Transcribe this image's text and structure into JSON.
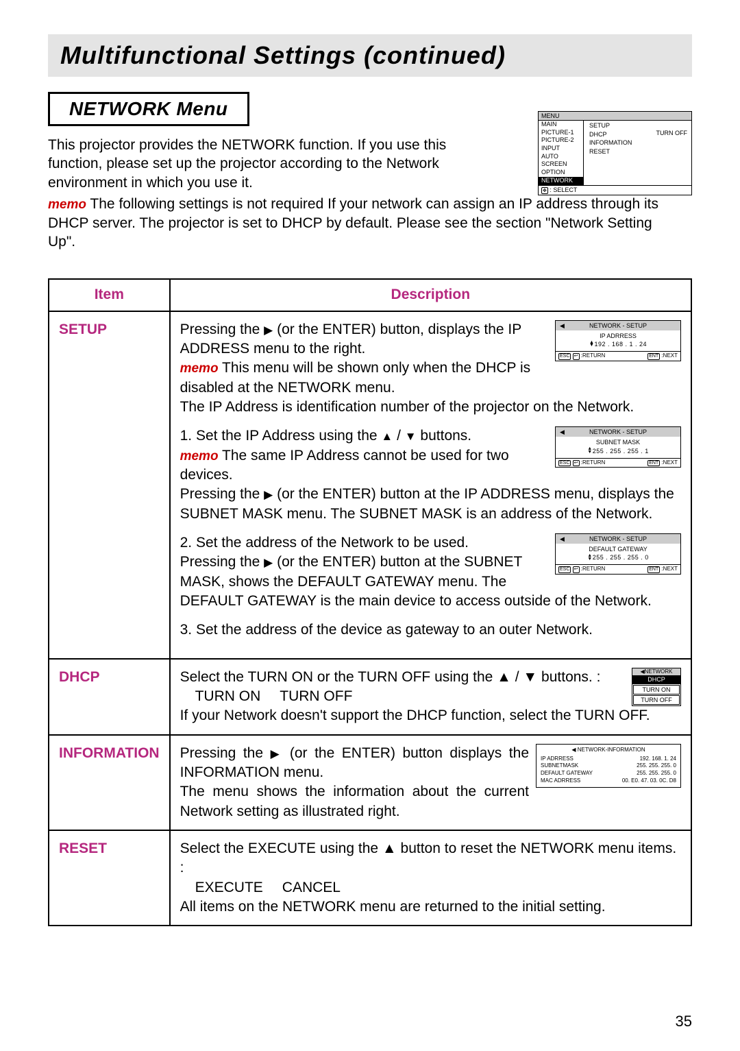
{
  "page_title": "Multifunctional Settings (continued)",
  "section_title": "NETWORK Menu",
  "intro": "This projector provides the NETWORK function. If you use this function, please set up the projector according to the Network environment in which you use it.",
  "memo_label": "memo",
  "memo_text": " The following settings is not required If your network can assign an IP address through its DHCP server.  The projector is set to DHCP by default. Please see the section \"Network Setting Up\".",
  "menu_box": {
    "title": "MENU",
    "left": [
      "MAIN",
      "PICTURE-1",
      "PICTURE-2",
      "INPUT",
      "AUTO",
      "SCREEN",
      "OPTION",
      "NETWORK"
    ],
    "right": [
      "SETUP",
      "DHCP",
      "INFORMATION",
      "RESET"
    ],
    "turnoff": "TURN OFF",
    "footer": ": SELECT"
  },
  "table": {
    "head_item": "Item",
    "head_desc": "Description",
    "rows": [
      {
        "item": "SETUP",
        "paras": [
          "Pressing the ▶ (or the ENTER) button, displays the IP ADDRESS menu to the right.\n<memo> This menu will be shown only when the DHCP is disabled at the NETWORK menu.\nThe IP Address is identification number of the projector on the Network.",
          "1. Set the IP Address using the ▲ / ▼ buttons.\n<memo> The same IP Address cannot be used for two devices.\nPressing the ▶ (or the ENTER) button at the IP ADDRESS menu, displays the SUBNET MASK menu. The SUBNET MASK is an address of the Network.",
          "2. Set the address of the Network to be used.\nPressing the ▶ (or the ENTER) button at the SUBNET MASK, shows the DEFAULT GATEWAY menu. The DEFAULT GATEWAY is the main device to access outside of the Network.",
          "3. Set the address of the device as gateway to an outer Network."
        ],
        "illus": [
          {
            "title": "NETWORK - SETUP",
            "sub": "IP ADRRESS",
            "val": "192 . 168 . 1 . 24",
            "ret": ":RETURN",
            "nxt": ":NEXT",
            "esc": "ESC",
            "ent": "ENT"
          },
          {
            "title": "NETWORK - SETUP",
            "sub": "SUBNET MASK",
            "val": "255 . 255 . 255 . 1",
            "ret": ":RETURN",
            "nxt": ":NEXT",
            "esc": "ESC",
            "ent": "ENT"
          },
          {
            "title": "NETWORK - SETUP",
            "sub": "DEFAULT GATEWAY",
            "val": "255 . 255 . 255 . 0",
            "ret": ":RETURN",
            "nxt": ":NEXT",
            "esc": "ESC",
            "ent": "ENT"
          }
        ]
      },
      {
        "item": "DHCP",
        "text": "Select the TURN ON or the TURN OFF using the ▲ / ▼ buttons. :",
        "opt1": "TURN ON",
        "opt2": "TURN OFF",
        "text2": "If your Network doesn't support the DHCP function, select the TURN OFF.",
        "illus": {
          "hdr": "◀NETWORK",
          "l1": "DHCP",
          "l2": "TURN ON",
          "l3": "TURN OFF"
        }
      },
      {
        "item": "INFORMATION",
        "text": "Pressing the ▶ (or the ENTER) button displays the INFORMATION menu.\nThe menu shows the information about the current Network setting as illustrated right.",
        "illus": {
          "hdr": "◀ NETWORK-INFORMATION",
          "rows": [
            {
              "k": "IP ADRRESS",
              "v": "192. 168. 1. 24"
            },
            {
              "k": "SUBNETMASK",
              "v": "255. 255. 255. 0"
            },
            {
              "k": "DEFAULT GATEWAY",
              "v": "255. 255. 255. 0"
            },
            {
              "k": "MAC ADRRESS",
              "v": "00. E0. 47. 03. 0C. D8"
            }
          ]
        }
      },
      {
        "item": "RESET",
        "text": "Select the EXECUTE using the ▲ button to reset the NETWORK menu items. :",
        "opt1": "EXECUTE",
        "opt2": "CANCEL",
        "text2": "All items on the NETWORK menu are returned to the initial setting."
      }
    ]
  },
  "page_number": "35"
}
